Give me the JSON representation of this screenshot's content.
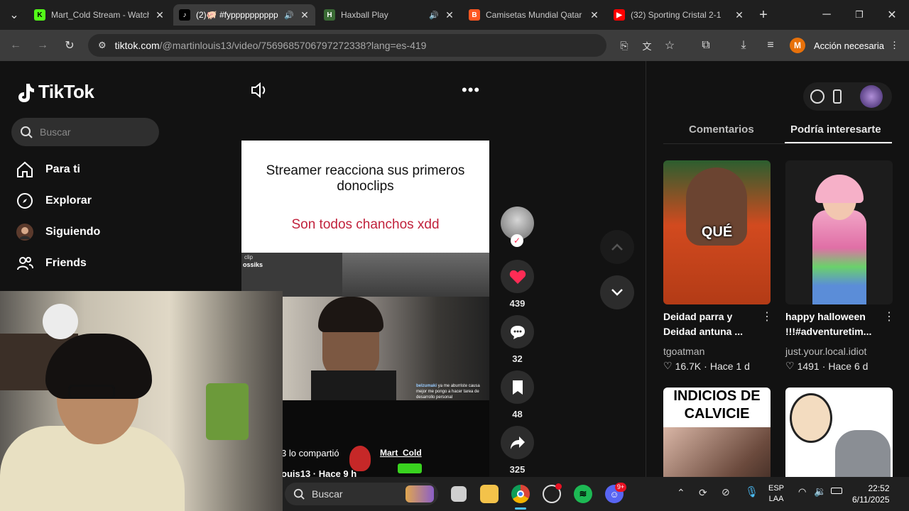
{
  "browser": {
    "tabs": [
      {
        "title": "Mart_Cold Stream - Watch",
        "icon": "kick-icon",
        "color": "#53fc18"
      },
      {
        "title": "(2)🐖 #fypppppppppp",
        "icon": "tiktok-icon",
        "color": "#000000",
        "audio": true
      },
      {
        "title": "Haxball Play",
        "icon": "haxball-icon",
        "color": "#3a6b35",
        "audio": true
      },
      {
        "title": "Camisetas Mundial Qatar",
        "icon": "blogger-icon",
        "color": "#ff5722"
      },
      {
        "title": "(32) Sporting Cristal 2-1",
        "icon": "youtube-icon",
        "color": "#ff0000"
      }
    ],
    "url_host": "tiktok.com",
    "url_path": "/@martinlouis13/video/7569685706797272338?lang=es-419",
    "profile_initial": "M",
    "action_label": "Acción necesaria"
  },
  "tiktok": {
    "logo": "TikTok",
    "search_placeholder": "Buscar",
    "nav": [
      {
        "label": "Para ti",
        "icon": "home-icon"
      },
      {
        "label": "Explorar",
        "icon": "compass-icon"
      },
      {
        "label": "Siguiendo",
        "icon": "avatar-icon"
      },
      {
        "label": "Friends",
        "icon": "friends-icon"
      }
    ],
    "video": {
      "caption_title": "Streamer reacciona sus primeros donoclips",
      "caption_sub": "Son todos chanchos xdd",
      "chat_user": "belzumaki",
      "chat_text": "ya me aburriste causa mejor me pongo a hacer tarea de desarrollo personal",
      "clip_label": "clip",
      "clip_user": "ossiks",
      "shared_text": "3 lo compartió",
      "author_line": "ouis13 · Hace 9 h",
      "streamer_name": "Mart_Cold"
    },
    "actions": {
      "likes": "439",
      "comments": "32",
      "saves": "48",
      "shares": "325"
    },
    "panel": {
      "tabs": [
        "Comentarios",
        "Podría interesarte"
      ],
      "cards": [
        {
          "title1": "Deidad parra y",
          "title2": "Deidad antuna ...",
          "author": "tgoatman",
          "likes": "16.7K",
          "age": "Hace 1 d",
          "overlay": "QUÉ"
        },
        {
          "title1": "happy halloween",
          "title2": "!!!#adventuretim...",
          "author": "just.your.local.idiot",
          "likes": "1491",
          "age": "Hace 6 d",
          "overlay": ""
        },
        {
          "overlay": "INDICIOS DE CALVICIE"
        },
        {
          "overlay": ""
        }
      ]
    }
  },
  "taskbar": {
    "search_placeholder": "Buscar",
    "lang1": "ESP",
    "lang2": "LAA",
    "time": "22:52",
    "date": "6/11/2025",
    "discord_badge": "9+"
  }
}
